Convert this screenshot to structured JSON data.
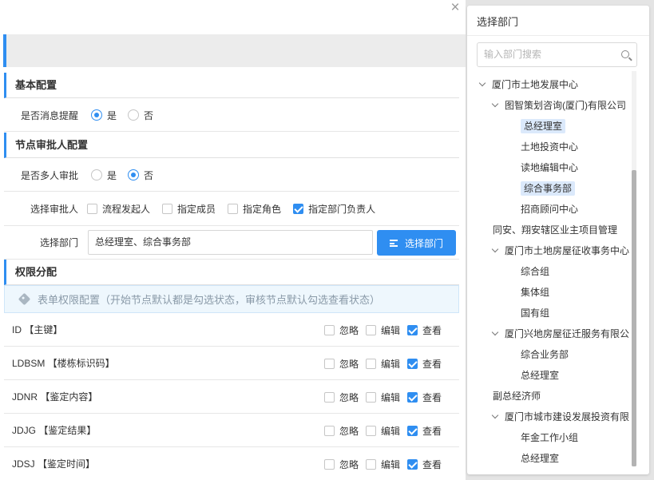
{
  "window": {
    "close_glyph": "×"
  },
  "sections": {
    "basic": "基本配置",
    "approver": "节点审批人配置",
    "permissions": "权限分配"
  },
  "basic": {
    "notify_label": "是否消息提醒",
    "yes": "是",
    "no": "否",
    "notify_value": "是"
  },
  "approver": {
    "multi_label": "是否多人审批",
    "yes": "是",
    "no": "否",
    "multi_value": "否",
    "select_label": "选择审批人",
    "options": [
      {
        "label": "流程发起人",
        "checked": false
      },
      {
        "label": "指定成员",
        "checked": false
      },
      {
        "label": "指定角色",
        "checked": false
      },
      {
        "label": "指定部门负责人",
        "checked": true
      }
    ],
    "dept_label": "选择部门",
    "dept_value": "总经理室、综合事务部",
    "dept_button": "选择部门"
  },
  "permissions": {
    "info": "表单权限配置（开始节点默认都是勾选状态，审核节点默认勾选查看状态）",
    "col_ignore": "忽略",
    "col_edit": "编辑",
    "col_view": "查看",
    "fields": [
      {
        "name": "ID 【主键】",
        "ignore": false,
        "edit": false,
        "view": true
      },
      {
        "name": "LDBSM 【楼栋标识码】",
        "ignore": false,
        "edit": false,
        "view": true
      },
      {
        "name": "JDNR 【鉴定内容】",
        "ignore": false,
        "edit": false,
        "view": true
      },
      {
        "name": "JDJG 【鉴定结果】",
        "ignore": false,
        "edit": false,
        "view": true
      },
      {
        "name": "JDSJ 【鉴定时间】",
        "ignore": false,
        "edit": false,
        "view": true
      }
    ]
  },
  "dept_panel": {
    "title": "选择部门",
    "search_placeholder": "输入部门搜索",
    "tree": [
      {
        "label": "厦门市土地发展中心",
        "level": 0,
        "expanded": true,
        "selected": false
      },
      {
        "label": "图智策划咨询(厦门)有限公司",
        "level": 1,
        "expanded": true,
        "selected": false
      },
      {
        "label": "总经理室",
        "level": 2,
        "selected": true
      },
      {
        "label": "土地投资中心",
        "level": 2,
        "selected": false
      },
      {
        "label": "读地编辑中心",
        "level": 2,
        "selected": false
      },
      {
        "label": "综合事务部",
        "level": 2,
        "selected": true
      },
      {
        "label": "招商顾问中心",
        "level": 2,
        "selected": false
      },
      {
        "label": "同安、翔安辖区业主项目管理",
        "level": 1,
        "selected": false
      },
      {
        "label": "厦门市土地房屋征收事务中心",
        "level": 1,
        "expanded": true,
        "selected": false
      },
      {
        "label": "综合组",
        "level": 2,
        "selected": false
      },
      {
        "label": "集体组",
        "level": 2,
        "selected": false
      },
      {
        "label": "国有组",
        "level": 2,
        "selected": false
      },
      {
        "label": "厦门兴地房屋征迁服务有限公",
        "level": 1,
        "expanded": true,
        "selected": false
      },
      {
        "label": "综合业务部",
        "level": 2,
        "selected": false
      },
      {
        "label": "总经理室",
        "level": 2,
        "selected": false
      },
      {
        "label": "副总经济师",
        "level": 1,
        "selected": false
      },
      {
        "label": "厦门市城市建设发展投资有限",
        "level": 1,
        "expanded": true,
        "selected": false
      },
      {
        "label": "年金工作小组",
        "level": 2,
        "selected": false
      },
      {
        "label": "总经理室",
        "level": 2,
        "selected": false
      }
    ]
  },
  "colors": {
    "accent": "#2f8ef1",
    "selected_bg": "#dbe9fb",
    "info_bg": "#eef7fd"
  }
}
